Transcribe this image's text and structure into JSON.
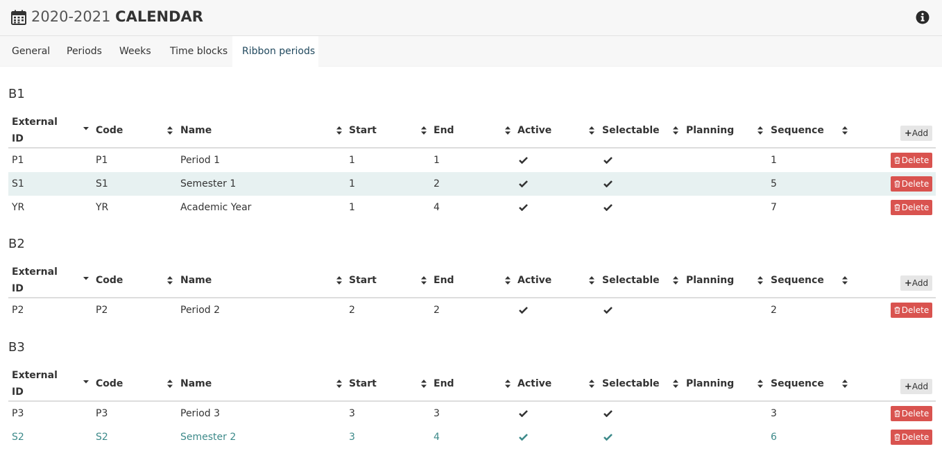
{
  "header": {
    "title_year": "2020-2021",
    "title_word": "CALENDAR",
    "calendar_icon": "calendar-icon",
    "info_icon": "info-circle-icon"
  },
  "tabs": [
    {
      "label": "General",
      "active": false
    },
    {
      "label": "Periods",
      "active": false
    },
    {
      "label": "Weeks",
      "active": false
    },
    {
      "label": "Time blocks",
      "active": false
    },
    {
      "label": "Ribbon periods",
      "active": true
    }
  ],
  "columns": {
    "external_id_line1": "External",
    "external_id_line2": "ID",
    "code": "Code",
    "name": "Name",
    "start": "Start",
    "end": "End",
    "active": "Active",
    "selectable": "Selectable",
    "planning": "Planning",
    "sequence": "Sequence"
  },
  "add_label": "Add",
  "delete_label": "Delete",
  "colors": {
    "delete_bg": "#d9534f",
    "stripe_bg": "#e7f1f1",
    "teal_text": "#3d8a8a",
    "active_tab_text": "#21495e"
  },
  "sections": [
    {
      "title": "B1",
      "rows": [
        {
          "external_id": "P1",
          "code": "P1",
          "name": "Period 1",
          "start": "1",
          "end": "1",
          "active": true,
          "selectable": true,
          "planning": "",
          "sequence": "1"
        },
        {
          "external_id": "S1",
          "code": "S1",
          "name": "Semester 1",
          "start": "1",
          "end": "2",
          "active": true,
          "selectable": true,
          "planning": "",
          "sequence": "5"
        },
        {
          "external_id": "YR",
          "code": "YR",
          "name": "Academic Year",
          "start": "1",
          "end": "4",
          "active": true,
          "selectable": true,
          "planning": "",
          "sequence": "7"
        }
      ]
    },
    {
      "title": "B2",
      "rows": [
        {
          "external_id": "P2",
          "code": "P2",
          "name": "Period 2",
          "start": "2",
          "end": "2",
          "active": true,
          "selectable": true,
          "planning": "",
          "sequence": "2"
        }
      ]
    },
    {
      "title": "B3",
      "rows": [
        {
          "external_id": "P3",
          "code": "P3",
          "name": "Period 3",
          "start": "3",
          "end": "3",
          "active": true,
          "selectable": true,
          "planning": "",
          "sequence": "3"
        },
        {
          "external_id": "S2",
          "code": "S2",
          "name": "Semester 2",
          "start": "3",
          "end": "4",
          "active": true,
          "selectable": true,
          "planning": "",
          "sequence": "6"
        }
      ]
    }
  ]
}
